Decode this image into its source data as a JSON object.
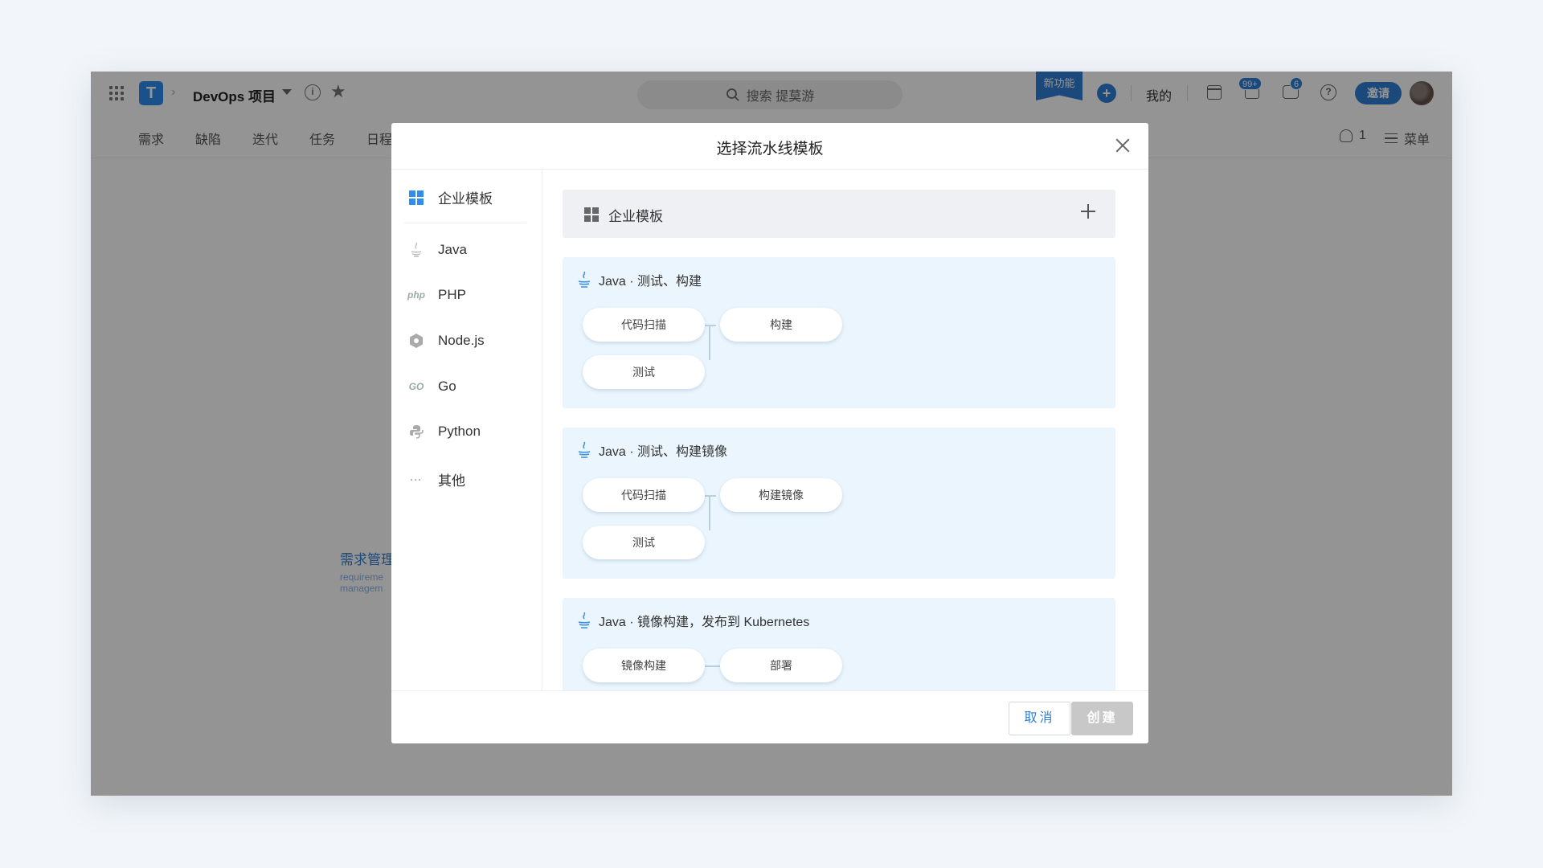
{
  "app": {
    "project_name": "DevOps 项目",
    "search_placeholder": "搜索 提莫游",
    "new_feature_label": "新功能",
    "mine_label": "我的",
    "notif_badge": "99+",
    "msg_badge": "6",
    "invite_label": "邀请",
    "nav": [
      "需求",
      "缺陷",
      "迭代",
      "任务",
      "日程"
    ],
    "member_count": "1",
    "menu_label": "菜单",
    "bg_link": "需求管理",
    "bg_sub_1": "requireme",
    "bg_sub_2": "managem"
  },
  "modal": {
    "title": "选择流水线模板",
    "sidebar": [
      {
        "label": "企业模板",
        "icon": "enterprise-grid-icon"
      },
      {
        "label": "Java",
        "icon": "java-icon"
      },
      {
        "label": "PHP",
        "icon": "php-icon"
      },
      {
        "label": "Node.js",
        "icon": "nodejs-icon"
      },
      {
        "label": "Go",
        "icon": "go-icon"
      },
      {
        "label": "Python",
        "icon": "python-icon"
      },
      {
        "label": "其他",
        "icon": "more-icon"
      }
    ],
    "enterprise_card_label": "企业模板",
    "templates": [
      {
        "title": "Java · 测试、构建",
        "stages": [
          "代码扫描",
          "测试",
          "构建"
        ]
      },
      {
        "title": "Java · 测试、构建镜像",
        "stages": [
          "代码扫描",
          "测试",
          "构建镜像"
        ]
      },
      {
        "title": "Java · 镜像构建，发布到 Kubernetes",
        "stages": [
          "镜像构建",
          "部署"
        ]
      }
    ],
    "cancel_label": "取消",
    "create_label": "创建"
  },
  "colors": {
    "accent": "#2f7fd6",
    "template_bg": "#eaf5fd",
    "disabled_button": "#c8c8c8"
  }
}
